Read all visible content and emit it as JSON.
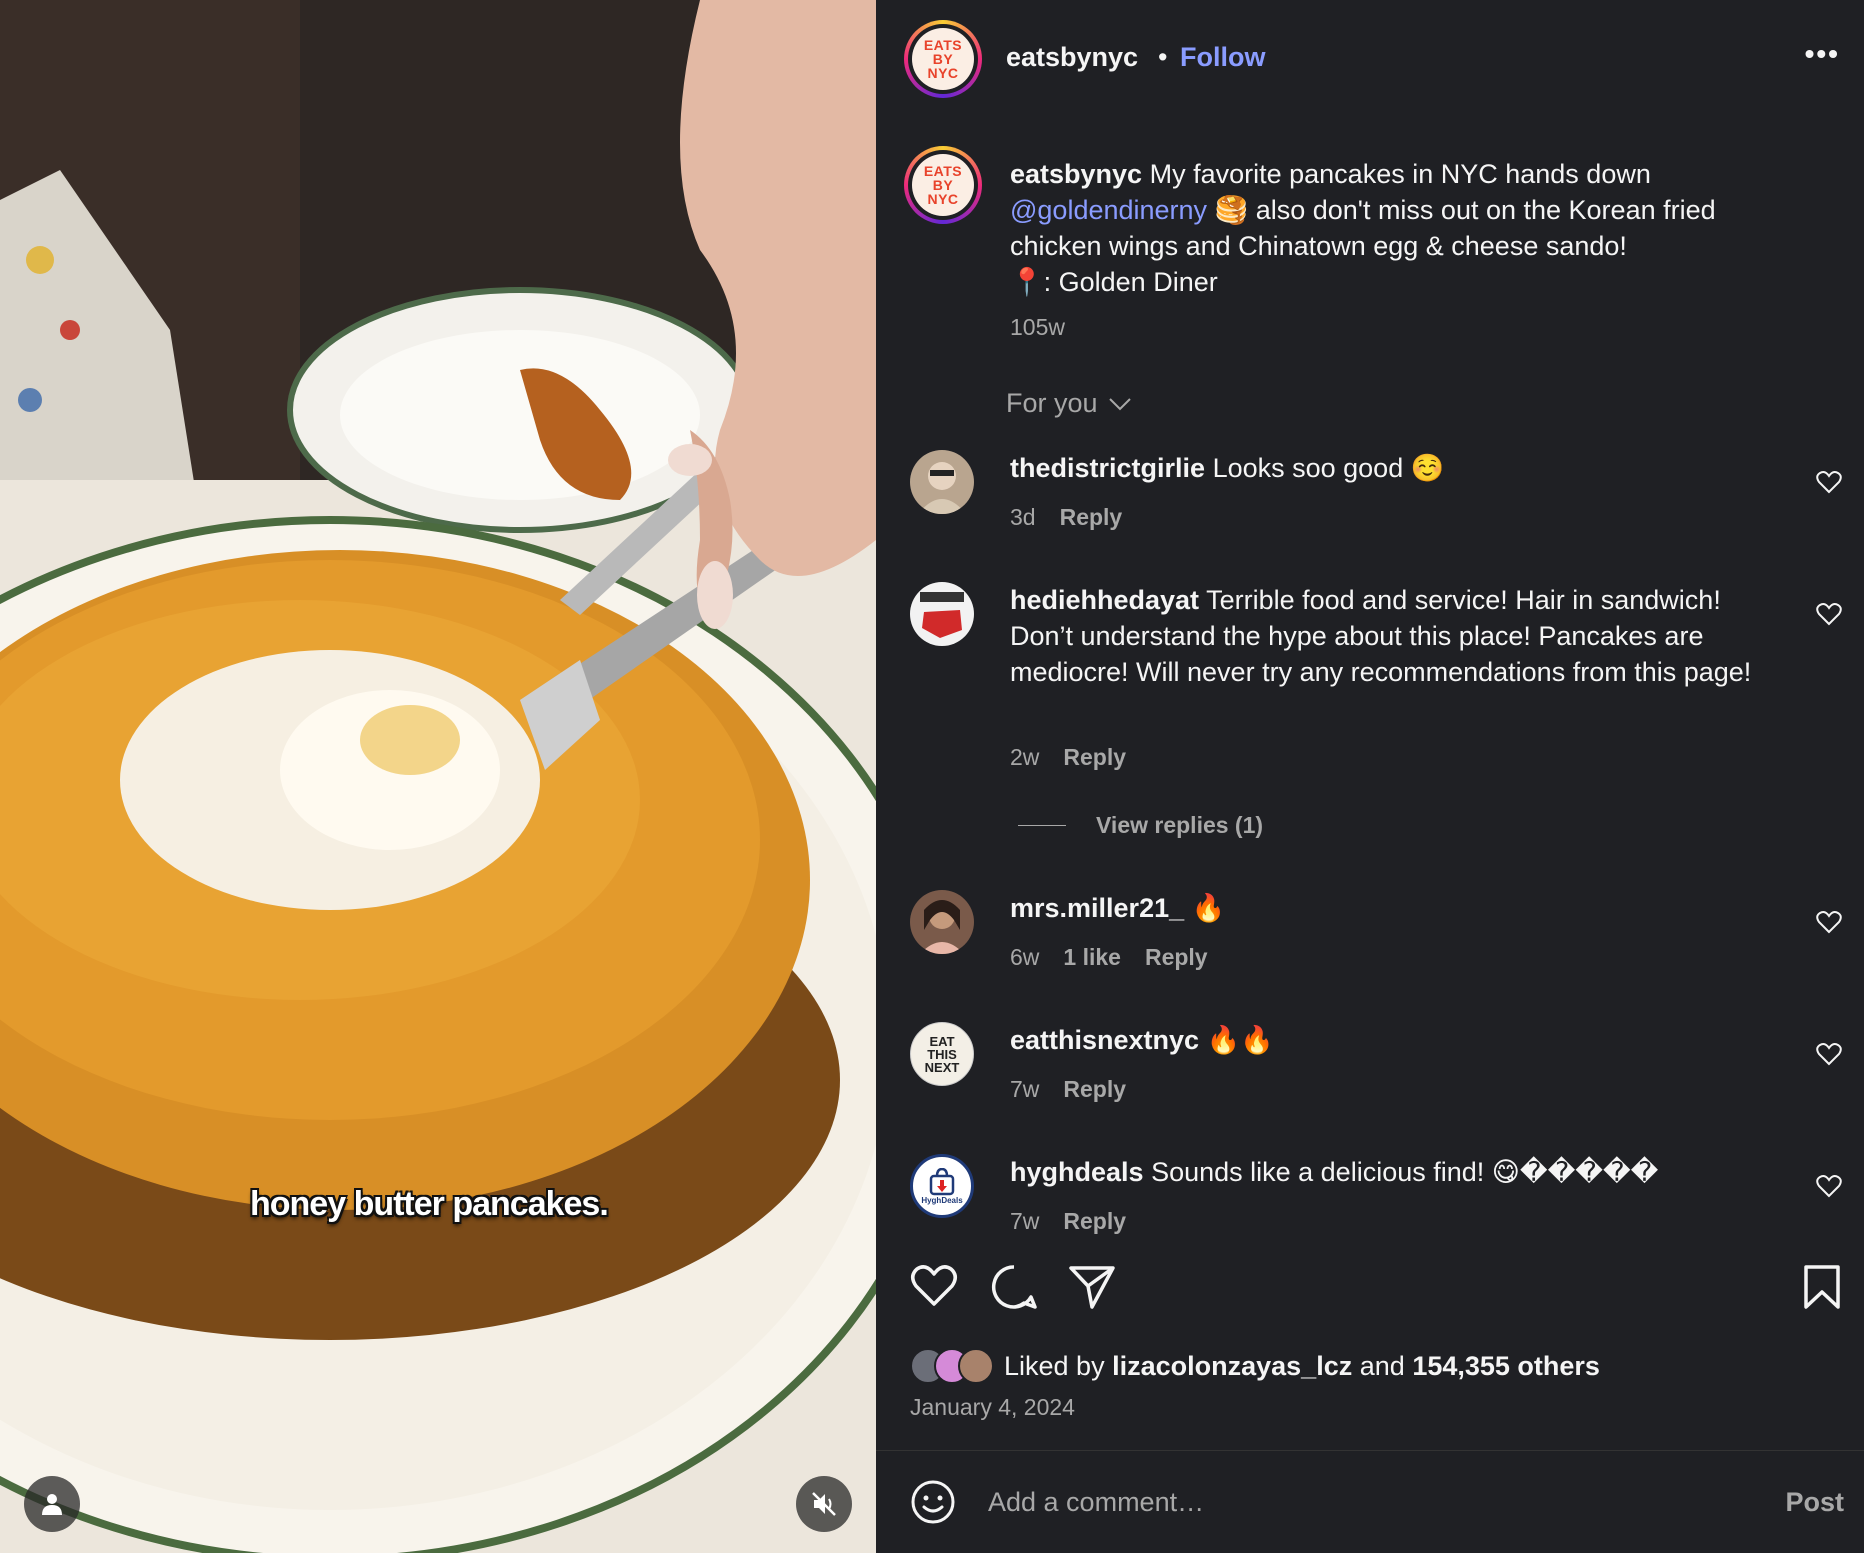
{
  "media": {
    "caption_overlay": "honey butter pancakes.",
    "user_tag_icon": "person-icon",
    "mute_icon": "speaker-muted-icon"
  },
  "header": {
    "username": "eatsbynyc",
    "separator": "•",
    "follow_label": "Follow",
    "more_label": "•••",
    "avatar_lines": [
      "EATS",
      "BY",
      "NYC"
    ]
  },
  "caption": {
    "username": "eatsbynyc",
    "text_before": "My favorite pancakes in NYC hands down",
    "mention": "@goldendinerny",
    "emoji": "🥞",
    "text_after": "also don't miss out on the Korean fried chicken wings and Chinatown egg & cheese sando!",
    "location_pin": "📍",
    "location": ": Golden Diner",
    "time": "105w"
  },
  "comments_sort": {
    "label": "For you"
  },
  "comments": [
    {
      "username": "thedistrictgirlie",
      "text": "Looks soo good ☺️",
      "time": "3d",
      "likes": "",
      "reply": "Reply"
    },
    {
      "username": "hediehhedayat",
      "text": "Terrible food and service! Hair in sandwich! Don’t understand the hype about this place! Pancakes are mediocre! Will never try any recommendations from this page!",
      "time": "2w",
      "likes": "",
      "reply": "Reply"
    },
    {
      "username": "mrs.miller21_",
      "text": "🔥",
      "time": "6w",
      "likes": "1 like",
      "reply": "Reply"
    },
    {
      "username": "eatthisnextnyc",
      "text": "🔥🔥",
      "time": "7w",
      "likes": "",
      "reply": "Reply"
    },
    {
      "username": "hyghdeals",
      "text": "Sounds like a delicious find! 😋�����",
      "time": "7w",
      "likes": "",
      "reply": "Reply"
    }
  ],
  "view_replies": "View replies (1)",
  "eatthisnext_avatar_lines": [
    "EAT",
    "THIS",
    "NEXT"
  ],
  "hyghdeals_avatar_label": "HyghDeals",
  "likes": {
    "prefix": "Liked by",
    "user": "lizacolonzayas_lcz",
    "middle": "and",
    "count": "154,355 others"
  },
  "post_date": "January 4, 2024",
  "comment_box": {
    "placeholder": "Add a comment…",
    "post_label": "Post"
  },
  "colors": {
    "background": "#1f2024",
    "accent_link": "#8a9cff",
    "secondary_text": "#a8a8a8",
    "logo_red": "#e8432b"
  }
}
